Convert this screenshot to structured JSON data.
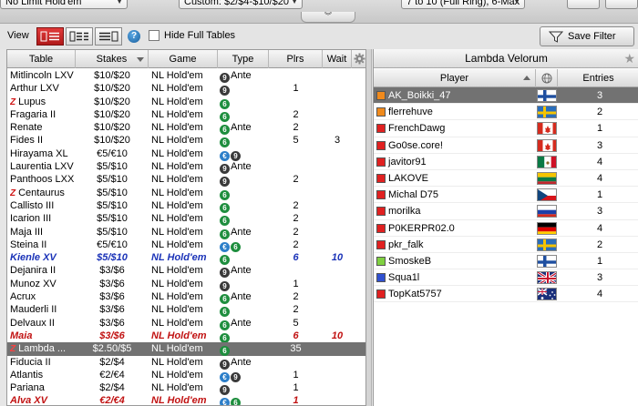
{
  "filters": {
    "game": "No Limit Hold'em",
    "stakes": "Custom: $2/$4-$10/$20",
    "seats": "7 to 10 (Full Ring), 6-Max"
  },
  "toolbar": {
    "view_label": "View",
    "hide_full_tables_label": "Hide Full Tables",
    "save_filter_label": "Save Filter",
    "help_glyph": "?"
  },
  "table_list": {
    "columns": [
      "Table",
      "Stakes",
      "Game",
      "Type",
      "Plrs",
      "Wait"
    ],
    "rows": [
      {
        "name": "Mitlincoln LXV",
        "stakes": "$10/$20",
        "game": "NL Hold'em",
        "badges": [
          "9"
        ],
        "type_text": "Ante",
        "plrs": "",
        "wait": ""
      },
      {
        "name": "Arthur LXV",
        "stakes": "$10/$20",
        "game": "NL Hold'em",
        "badges": [
          "9"
        ],
        "type_text": "",
        "plrs": "1",
        "wait": ""
      },
      {
        "name": "Lupus",
        "stakes": "$10/$20",
        "game": "NL Hold'em",
        "badges": [
          "6"
        ],
        "type_text": "",
        "plrs": "",
        "wait": "",
        "mark": "Z"
      },
      {
        "name": "Fragaria II",
        "stakes": "$10/$20",
        "game": "NL Hold'em",
        "badges": [
          "6"
        ],
        "type_text": "",
        "plrs": "2",
        "wait": ""
      },
      {
        "name": "Renate",
        "stakes": "$10/$20",
        "game": "NL Hold'em",
        "badges": [
          "6"
        ],
        "type_text": "Ante",
        "plrs": "2",
        "wait": ""
      },
      {
        "name": "Fides II",
        "stakes": "$10/$20",
        "game": "NL Hold'em",
        "badges": [
          "6"
        ],
        "type_text": "",
        "plrs": "5",
        "wait": "3"
      },
      {
        "name": "Hirayama XL",
        "stakes": "€5/€10",
        "game": "NL Hold'em",
        "badges": [
          "€",
          "9"
        ],
        "type_text": "",
        "plrs": "",
        "wait": ""
      },
      {
        "name": "Laurentia LXV",
        "stakes": "$5/$10",
        "game": "NL Hold'em",
        "badges": [
          "9"
        ],
        "type_text": "Ante",
        "plrs": "",
        "wait": ""
      },
      {
        "name": "Panthoos LXX",
        "stakes": "$5/$10",
        "game": "NL Hold'em",
        "badges": [
          "9"
        ],
        "type_text": "",
        "plrs": "2",
        "wait": ""
      },
      {
        "name": "Centaurus",
        "stakes": "$5/$10",
        "game": "NL Hold'em",
        "badges": [
          "6"
        ],
        "type_text": "",
        "plrs": "",
        "wait": "",
        "mark": "Z"
      },
      {
        "name": "Callisto III",
        "stakes": "$5/$10",
        "game": "NL Hold'em",
        "badges": [
          "6"
        ],
        "type_text": "",
        "plrs": "2",
        "wait": ""
      },
      {
        "name": "Icarion III",
        "stakes": "$5/$10",
        "game": "NL Hold'em",
        "badges": [
          "6"
        ],
        "type_text": "",
        "plrs": "2",
        "wait": ""
      },
      {
        "name": "Maja III",
        "stakes": "$5/$10",
        "game": "NL Hold'em",
        "badges": [
          "6"
        ],
        "type_text": "Ante",
        "plrs": "2",
        "wait": ""
      },
      {
        "name": "Steina II",
        "stakes": "€5/€10",
        "game": "NL Hold'em",
        "badges": [
          "€",
          "6"
        ],
        "type_text": "",
        "plrs": "2",
        "wait": ""
      },
      {
        "name": "Kienle XV",
        "stakes": "$5/$10",
        "game": "NL Hold'em",
        "badges": [
          "6"
        ],
        "type_text": "",
        "plrs": "6",
        "wait": "10",
        "style": "blue"
      },
      {
        "name": "Dejanira II",
        "stakes": "$3/$6",
        "game": "NL Hold'em",
        "badges": [
          "9"
        ],
        "type_text": "Ante",
        "plrs": "",
        "wait": ""
      },
      {
        "name": "Munoz XV",
        "stakes": "$3/$6",
        "game": "NL Hold'em",
        "badges": [
          "9"
        ],
        "type_text": "",
        "plrs": "1",
        "wait": ""
      },
      {
        "name": "Acrux",
        "stakes": "$3/$6",
        "game": "NL Hold'em",
        "badges": [
          "6"
        ],
        "type_text": "Ante",
        "plrs": "2",
        "wait": ""
      },
      {
        "name": "Mauderli II",
        "stakes": "$3/$6",
        "game": "NL Hold'em",
        "badges": [
          "6"
        ],
        "type_text": "",
        "plrs": "2",
        "wait": ""
      },
      {
        "name": "Delvaux II",
        "stakes": "$3/$6",
        "game": "NL Hold'em",
        "badges": [
          "6"
        ],
        "type_text": "Ante",
        "plrs": "5",
        "wait": ""
      },
      {
        "name": "Maia",
        "stakes": "$3/$6",
        "game": "NL Hold'em",
        "badges": [
          "6"
        ],
        "type_text": "",
        "plrs": "6",
        "wait": "10",
        "style": "red"
      },
      {
        "name": "Lambda ...",
        "stakes": "$2.50/$5",
        "game": "NL Hold'em",
        "badges": [
          "6"
        ],
        "type_text": "",
        "plrs": "35",
        "wait": "",
        "mark": "Z",
        "style": "selected"
      },
      {
        "name": "Fiducia II",
        "stakes": "$2/$4",
        "game": "NL Hold'em",
        "badges": [
          "9"
        ],
        "type_text": "Ante",
        "plrs": "",
        "wait": ""
      },
      {
        "name": "Atlantis",
        "stakes": "€2/€4",
        "game": "NL Hold'em",
        "badges": [
          "€",
          "9"
        ],
        "type_text": "",
        "plrs": "1",
        "wait": ""
      },
      {
        "name": "Pariana",
        "stakes": "$2/$4",
        "game": "NL Hold'em",
        "badges": [
          "9"
        ],
        "type_text": "",
        "plrs": "1",
        "wait": ""
      },
      {
        "name": "Alva XV",
        "stakes": "€2/€4",
        "game": "NL Hold'em",
        "badges": [
          "€",
          "6"
        ],
        "type_text": "",
        "plrs": "1",
        "wait": "",
        "style": "red"
      }
    ]
  },
  "player_panel": {
    "title": "Lambda Velorum",
    "columns": [
      "Player",
      "",
      "Entries"
    ],
    "players": [
      {
        "name": "AK_Boikki_47",
        "entries": "3",
        "status_color": "#f08a1c",
        "flag": "finland",
        "selected": true
      },
      {
        "name": "flerrehuve",
        "entries": "2",
        "status_color": "#f08a1c",
        "flag": "sweden"
      },
      {
        "name": "FrenchDawg",
        "entries": "1",
        "status_color": "#e02020",
        "flag": "canada"
      },
      {
        "name": "Go0se.core!",
        "entries": "3",
        "status_color": "#e02020",
        "flag": "canada"
      },
      {
        "name": "javitor91",
        "entries": "4",
        "status_color": "#e02020",
        "flag": "mexico"
      },
      {
        "name": "LAKOVE",
        "entries": "4",
        "status_color": "#e02020",
        "flag": "lithuania"
      },
      {
        "name": "Michal D75",
        "entries": "1",
        "status_color": "#e02020",
        "flag": "czech"
      },
      {
        "name": "morilka",
        "entries": "3",
        "status_color": "#e02020",
        "flag": "russia"
      },
      {
        "name": "P0KERPR02.0",
        "entries": "4",
        "status_color": "#e02020",
        "flag": "germany"
      },
      {
        "name": "pkr_falk",
        "entries": "2",
        "status_color": "#e02020",
        "flag": "sweden"
      },
      {
        "name": "SmoskeB",
        "entries": "1",
        "status_color": "#7fd040",
        "flag": "finland"
      },
      {
        "name": "Squa1l",
        "entries": "3",
        "status_color": "#3050d0",
        "flag": "uk"
      },
      {
        "name": "TopKat5757",
        "entries": "4",
        "status_color": "#e02020",
        "flag": "australia"
      }
    ]
  },
  "colors": {
    "accent": "#c01a1a",
    "selected_row": "#727272",
    "featured_blue": "#1b33b8",
    "featured_red": "#c11212"
  }
}
